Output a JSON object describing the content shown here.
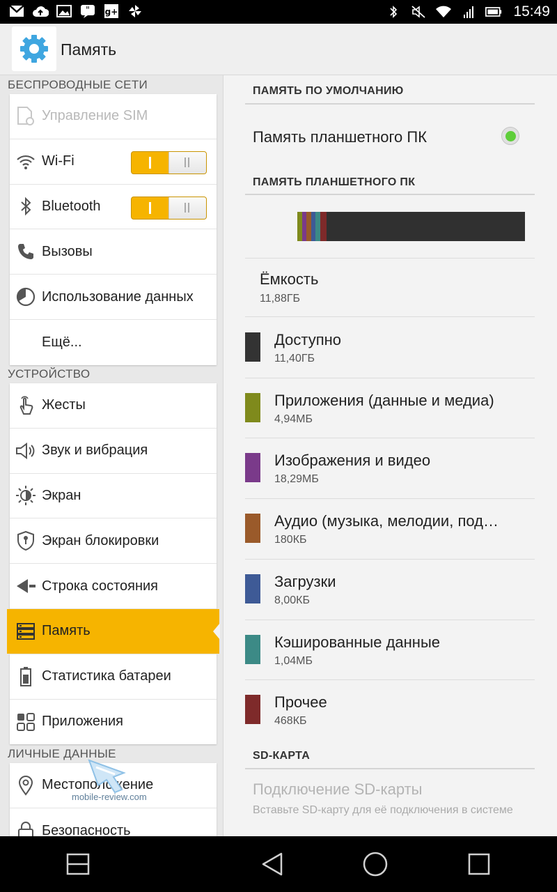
{
  "status_bar": {
    "time": "15:49"
  },
  "header": {
    "title": "Память"
  },
  "left_panel": {
    "sections": [
      {
        "header": "БЕСПРОВОДНЫЕ СЕТИ",
        "items": [
          {
            "label": "Управление SIM",
            "icon": "sim-icon",
            "disabled": true
          },
          {
            "label": "Wi-Fi",
            "icon": "wifi-icon",
            "toggle": "on"
          },
          {
            "label": "Bluetooth",
            "icon": "bluetooth-icon",
            "toggle": "on"
          },
          {
            "label": "Вызовы",
            "icon": "phone-icon"
          },
          {
            "label": "Использование данных",
            "icon": "data-usage-icon"
          },
          {
            "label": "Ещё...",
            "icon": ""
          }
        ]
      },
      {
        "header": "УСТРОЙСТВО",
        "items": [
          {
            "label": "Жесты",
            "icon": "gesture-icon"
          },
          {
            "label": "Звук и вибрация",
            "icon": "speaker-icon"
          },
          {
            "label": "Экран",
            "icon": "brightness-icon"
          },
          {
            "label": "Экран блокировки",
            "icon": "lock-screen-icon"
          },
          {
            "label": "Строка состояния",
            "icon": "status-bar-icon"
          },
          {
            "label": "Память",
            "icon": "storage-icon",
            "active": true
          },
          {
            "label": "Статистика батареи",
            "icon": "battery-icon"
          },
          {
            "label": "Приложения",
            "icon": "apps-icon"
          }
        ]
      },
      {
        "header": "ЛИЧНЫЕ ДАННЫЕ",
        "items": [
          {
            "label": "Местоположение",
            "icon": "location-icon"
          },
          {
            "label": "Безопасность",
            "icon": "security-icon"
          }
        ]
      }
    ]
  },
  "right_panel": {
    "default_header": "ПАМЯТЬ ПО УМОЛЧАНИЮ",
    "default_option": "Память планшетного ПК",
    "storage_header": "ПАМЯТЬ ПЛАНШЕТНОГО ПК",
    "capacity": {
      "title": "Ёмкость",
      "value": "11,88ГБ"
    },
    "usage_bar_fractions": [
      {
        "color": "#7f8a1c",
        "fraction": 0.02
      },
      {
        "color": "#7a3a8a",
        "fraction": 0.02
      },
      {
        "color": "#9a5a2a",
        "fraction": 0.02
      },
      {
        "color": "#3e5a96",
        "fraction": 0.02
      },
      {
        "color": "#3c8a86",
        "fraction": 0.02
      },
      {
        "color": "#7e2a2a",
        "fraction": 0.03
      }
    ],
    "items": [
      {
        "title": "Доступно",
        "value": "11,40ГБ",
        "color": "#333333"
      },
      {
        "title": "Приложения (данные и медиа)",
        "value": "4,94МБ",
        "color": "#7f8a1c"
      },
      {
        "title": "Изображения и видео",
        "value": "18,29МБ",
        "color": "#7a3a8a"
      },
      {
        "title": "Аудио (музыка, мелодии, под…",
        "value": "180КБ",
        "color": "#9a5a2a"
      },
      {
        "title": "Загрузки",
        "value": "8,00КБ",
        "color": "#3e5a96"
      },
      {
        "title": "Кэшированные данные",
        "value": "1,04МБ",
        "color": "#3c8a86"
      },
      {
        "title": "Прочее",
        "value": "468КБ",
        "color": "#7e2a2a"
      }
    ],
    "sd_header": "SD-КАРТА",
    "sd_title": "Подключение SD-карты",
    "sd_desc": "Вставьте SD-карту для её подключения в системе"
  },
  "watermark": {
    "text": "mobile-review.com"
  },
  "colors": {
    "accent": "#f6b400",
    "radio_on": "#5fce3a"
  }
}
